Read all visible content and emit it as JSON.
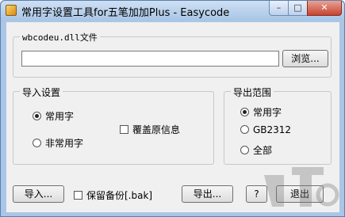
{
  "window": {
    "title": "常用字设置工具for五笔加加Plus   -   Easycode",
    "min_glyph": "–",
    "max_glyph": "□",
    "close_glyph": "✕"
  },
  "file_group": {
    "label": "wbcodeu.dll文件",
    "path_value": "",
    "browse_label": "浏览..."
  },
  "import_group": {
    "label": "导入设置",
    "option_common": "常用字",
    "option_common_selected": true,
    "option_uncommon": "非常用字",
    "overwrite_label": "覆盖原信息",
    "overwrite_checked": false
  },
  "export_group": {
    "label": "导出范围",
    "options": [
      "常用字",
      "GB2312",
      "全部"
    ],
    "selected_index": 0
  },
  "bottom": {
    "import_label": "导入...",
    "backup_label": "保留备份[.bak]",
    "backup_checked": false,
    "export_label": "导出...",
    "help_label": "?",
    "exit_label": "退出"
  },
  "colors": {
    "frame": "#a9c6e6",
    "client": "#f0f0f0",
    "close": "#c6452f"
  }
}
